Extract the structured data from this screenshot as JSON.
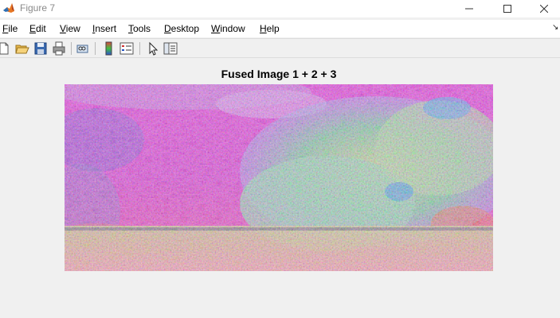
{
  "window": {
    "title": "Figure 7",
    "minimize_glyph": "—",
    "maximize_glyph": "☐",
    "close_glyph": "✕"
  },
  "menubar": {
    "items": [
      {
        "accel": "F",
        "rest": "ile"
      },
      {
        "accel": "E",
        "rest": "dit"
      },
      {
        "accel": "V",
        "rest": "iew"
      },
      {
        "accel": "I",
        "rest": "nsert"
      },
      {
        "accel": "T",
        "rest": "ools"
      },
      {
        "accel": "D",
        "rest": "esktop"
      },
      {
        "accel": "W",
        "rest": "indow"
      },
      {
        "accel": "H",
        "rest": "elp"
      }
    ],
    "overflow_glyph": "↘"
  },
  "toolbar": {
    "icons": [
      "new-figure-icon",
      "open-file-icon",
      "save-icon",
      "print-icon",
      "link-plot-icon",
      "insert-colorbar-icon",
      "insert-legend-icon",
      "edit-plot-icon",
      "property-inspector-icon"
    ]
  },
  "figure": {
    "title": "Fused Image 1 + 2 + 3"
  }
}
